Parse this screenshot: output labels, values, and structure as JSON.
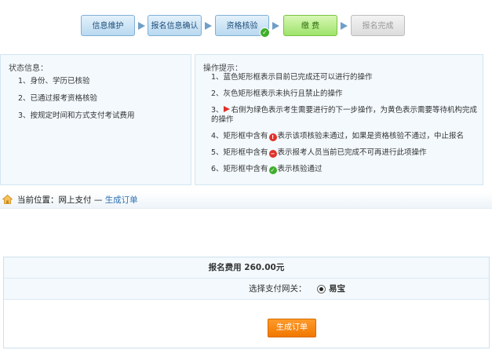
{
  "steps": [
    {
      "label": "信息维护",
      "state": "done"
    },
    {
      "label": "报名信息确认",
      "state": "done"
    },
    {
      "label": "资格核验",
      "state": "done-checked"
    },
    {
      "label": "缴 费",
      "state": "current"
    },
    {
      "label": "报名完成",
      "state": "disabled"
    }
  ],
  "status_panel": {
    "title": "状态信息：",
    "items": [
      "1、身份、学历已核验",
      "2、已通过报考资格核验",
      "3、按规定时间和方式支付考试费用"
    ]
  },
  "tips_panel": {
    "title": "操作提示：",
    "items": [
      {
        "pre": "1、蓝色矩形框表示目前已完成还可以进行的操作",
        "post": ""
      },
      {
        "pre": "2、灰色矩形框表示未执行且禁止的操作",
        "post": ""
      },
      {
        "pre": "3、",
        "post": "右侧为绿色表示考生需要进行的下一步操作，为黄色表示需要等待机构完成的操作"
      },
      {
        "pre": "4、矩形框中含有",
        "post": "表示该项核验未通过，如果是资格核验不通过，中止报名"
      },
      {
        "pre": "5、矩形框中含有",
        "post": "表示报考人员当前已完成不可再进行此项操作"
      },
      {
        "pre": "6、矩形框中含有",
        "post": "表示核验通过"
      }
    ]
  },
  "breadcrumb": {
    "prefix": "当前位置：",
    "section": "网上支付",
    "separator": " — ",
    "current": "生成订单"
  },
  "payment": {
    "fee_text": "报名费用 260.00元",
    "gateway_label": "选择支付网关：",
    "gateway_option": "易宝",
    "submit_label": "生成订单"
  },
  "colors": {
    "accent_blue": "#2b6fb0",
    "button_orange": "#f07800",
    "step_green": "#9ee36a"
  }
}
